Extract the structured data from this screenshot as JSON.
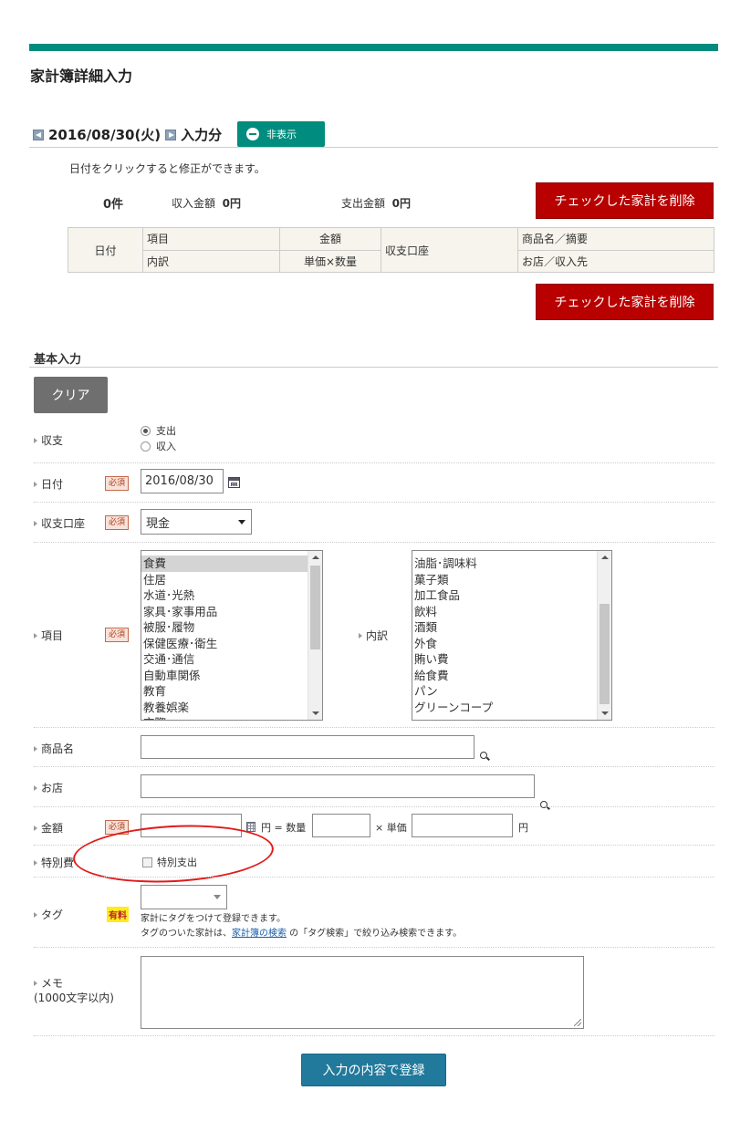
{
  "page": {
    "title": "家計簿詳細入力"
  },
  "list": {
    "date": "2016/08/30(火)",
    "suffix": "入力分",
    "hide_label": "非表示",
    "hint": "日付をクリックすると修正ができます。",
    "count": "0件",
    "income_label": "収入金額",
    "income_value": "0円",
    "expense_label": "支出金額",
    "expense_value": "0円",
    "delete_label": "チェックした家計を削除",
    "table": {
      "date": "日付",
      "item": "項目",
      "amount": "金額",
      "account": "収支口座",
      "product": "商品名／摘要",
      "breakdown": "内訳",
      "unit": "単価×数量",
      "shop": "お店／収入先"
    }
  },
  "form": {
    "heading": "基本入力",
    "clear_label": "クリア",
    "type": {
      "label": "収支",
      "options": [
        "支出",
        "収入"
      ],
      "selected": "支出"
    },
    "date": {
      "label": "日付",
      "required": "必須",
      "value": "2016/08/30"
    },
    "account": {
      "label": "収支口座",
      "required": "必須",
      "value": "現金"
    },
    "item": {
      "label": "項目",
      "required": "必須",
      "categories": [
        "食費",
        "住居",
        "水道･光熱",
        "家具･家事用品",
        "被服･履物",
        "保健医療･衛生",
        "交通･通信",
        "自動車関係",
        "教育",
        "教養娯楽",
        "交際"
      ],
      "selected": "食費"
    },
    "breakdown": {
      "label": "内訳",
      "options": [
        "油脂･調味料",
        "菓子類",
        "加工食品",
        "飲料",
        "酒類",
        "外食",
        "賄い費",
        "給食費",
        "パン",
        "グリーンコープ"
      ]
    },
    "product": {
      "label": "商品名",
      "value": ""
    },
    "shop": {
      "label": "お店",
      "value": ""
    },
    "amount": {
      "label": "金額",
      "required": "必須",
      "yen": "円",
      "eq": "=",
      "qty_label": "数量",
      "times": "×",
      "unit_label": "単価",
      "unit_yen": "円"
    },
    "special": {
      "label": "特別費",
      "checkbox_label": "特別支出"
    },
    "tag": {
      "label": "タグ",
      "paid": "有料",
      "note1": "家計にタグをつけて登録できます。",
      "note2_pre": "タグのついた家計は、",
      "note2_link": "家計簿の検索",
      "note2_post": " の「タグ検索」で絞り込み検索できます。"
    },
    "memo": {
      "label": "メモ",
      "limit": "(1000文字以内)"
    },
    "submit_label": "入力の内容で登録"
  }
}
